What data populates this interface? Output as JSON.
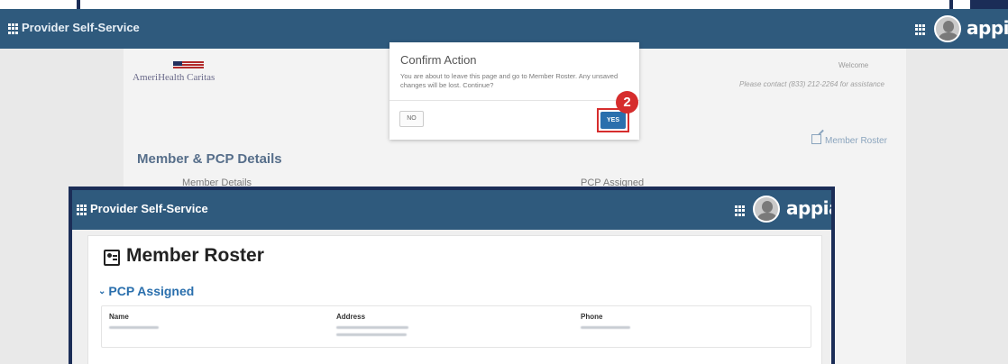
{
  "background_app": {
    "title": "Provider Self-Service",
    "brand": "appian",
    "logo_text": "AmeriHealth Caritas",
    "welcome": "Welcome",
    "contact": "Please contact (833) 212-2264 for assistance",
    "member_roster_link": "Member Roster",
    "section_title": "Member & PCP Details",
    "member_details_label": "Member Details",
    "pcp_assigned_label": "PCP Assigned"
  },
  "dialog": {
    "title": "Confirm Action",
    "message": "You are about to leave this page and go to Member Roster. Any unsaved changes will be lost. Continue?",
    "no_label": "NO",
    "yes_label": "YES"
  },
  "callout": {
    "step_number": "2",
    "color": "#d62d2d"
  },
  "overlay_window": {
    "title": "Provider Self-Service",
    "brand": "appian",
    "page_title": "Member Roster",
    "section_title": "PCP Assigned",
    "table": {
      "columns": [
        "Name",
        "Address",
        "Phone"
      ]
    }
  },
  "colors": {
    "header": "#2f5a7d",
    "frame": "#1b2d57",
    "link_blue": "#2a6fad"
  },
  "icons": {
    "app_menu": "grid-icon",
    "user": "avatar-icon",
    "external_link": "external-link-icon",
    "roster": "contact-card-icon",
    "section_toggle": "chevron-down-icon"
  }
}
